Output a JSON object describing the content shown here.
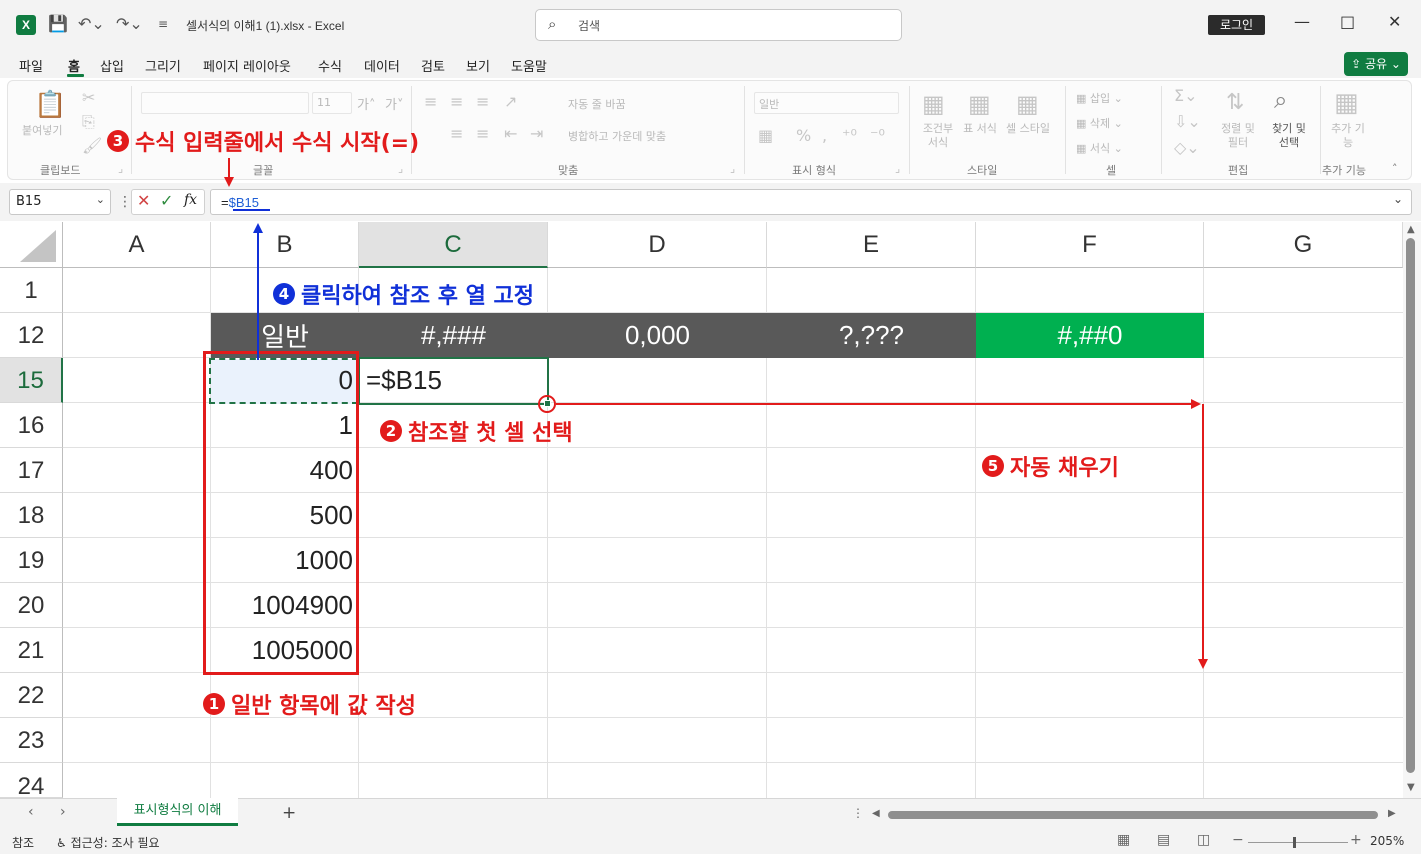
{
  "window": {
    "app_icon": "X",
    "doc_title": "셀서식의 이해1 (1).xlsx  -  Excel",
    "search_placeholder": "검색",
    "login_label": "로그인",
    "minimize": "—",
    "maximize": "□",
    "close": "✕"
  },
  "menu": {
    "items": [
      "파일",
      "홈",
      "삽입",
      "그리기",
      "페이지 레이아웃",
      "수식",
      "데이터",
      "검토",
      "보기",
      "도움말"
    ],
    "active": "홈",
    "share_label": "공유"
  },
  "ribbon": {
    "groups": [
      "클립보드",
      "글꼴",
      "맞춤",
      "표시 형식",
      "스타일",
      "셀",
      "편집",
      "추가 기능"
    ],
    "paste": "붙여넣기",
    "font_size": "11",
    "wrap_text": "자동 줄 바꿈",
    "merge_center": "병합하고 가운데 맞춤",
    "number_format": "일반",
    "cond_format": "조건부 서식",
    "table_format": "표 서식",
    "cell_styles": "셀 스타일",
    "insert": "삽입",
    "delete": "삭제",
    "format": "서식",
    "sort_filter": "정렬 및 필터",
    "find_select": "찾기 및 선택",
    "addins": "추가 기능"
  },
  "formula_bar": {
    "name_box": "B15",
    "formula_prefix": "=",
    "formula_ref": "$B15"
  },
  "grid": {
    "columns": [
      "A",
      "B",
      "C",
      "D",
      "E",
      "F",
      "G"
    ],
    "rows": [
      "1",
      "12",
      "15",
      "16",
      "17",
      "18",
      "19",
      "20",
      "21",
      "22",
      "23",
      "24"
    ],
    "header_row": {
      "B": "일반",
      "C": "#,###",
      "D": "0,000",
      "E": "?,???",
      "F": "#,##0"
    },
    "b_values": [
      "0",
      "1",
      "400",
      "500",
      "1000",
      "1004900",
      "1005000"
    ],
    "c15": "=$B15"
  },
  "annotations": {
    "step1": "일반 항목에 값 작성",
    "step2": "참조할 첫 셀 선택",
    "step3": "수식 입력줄에서 수식 시작(=)",
    "step4": "클릭하여 참조 후 열 고정",
    "step5": "자동 채우기",
    "badges": [
      "1",
      "2",
      "3",
      "4",
      "5"
    ]
  },
  "sheet_tabs": {
    "active": "표시형식의 이해",
    "add": "+"
  },
  "status_bar": {
    "mode": "참조",
    "accessibility": "접근성: 조사 필요",
    "zoom": "205%"
  },
  "colors": {
    "excel_green": "#107c41",
    "header_dark": "#595959",
    "header_green": "#00b050",
    "annotation_red": "#e21b1b",
    "annotation_blue": "#1030d8"
  }
}
